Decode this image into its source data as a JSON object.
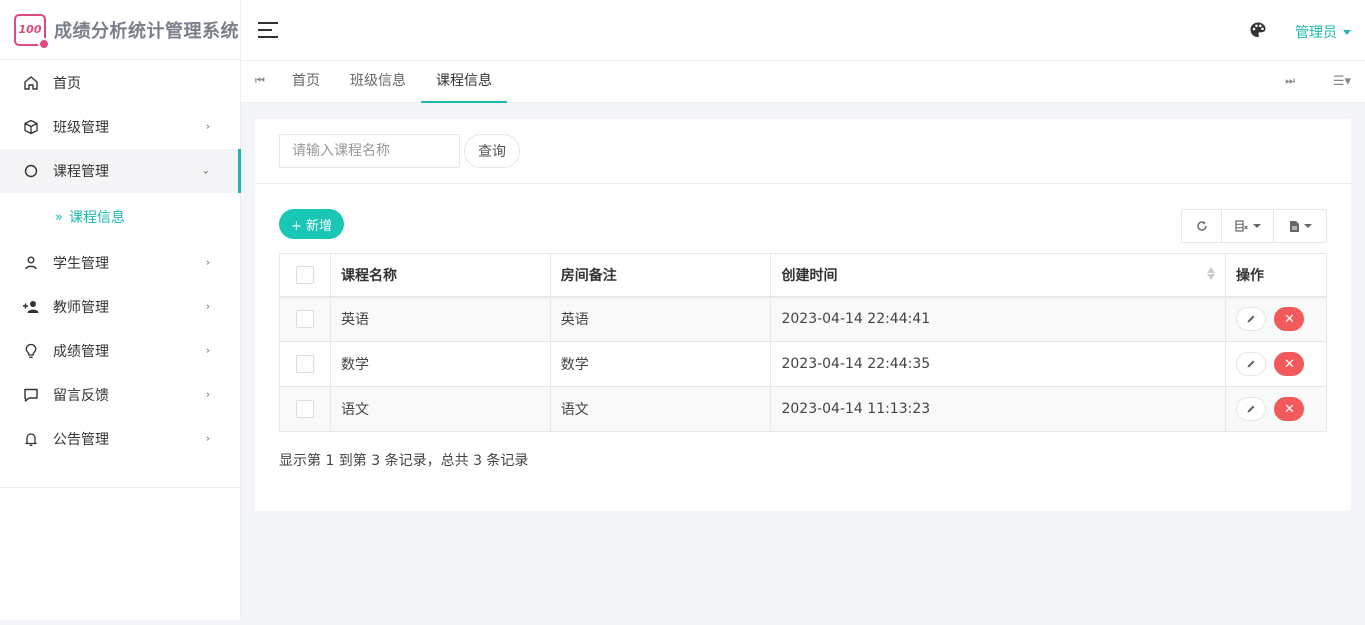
{
  "app": {
    "title": "成绩分析统计管理系统",
    "logo_text": "100"
  },
  "sidebar": {
    "items": [
      {
        "label": "首页",
        "icon": "home-icon",
        "has_arrow": false
      },
      {
        "label": "班级管理",
        "icon": "cube-icon",
        "has_arrow": true
      },
      {
        "label": "课程管理",
        "icon": "gear-icon",
        "has_arrow": true,
        "expanded": true
      },
      {
        "label": "学生管理",
        "icon": "user-icon",
        "has_arrow": true
      },
      {
        "label": "教师管理",
        "icon": "user-plus-icon",
        "has_arrow": true
      },
      {
        "label": "成绩管理",
        "icon": "lightbulb-icon",
        "has_arrow": true
      },
      {
        "label": "留言反馈",
        "icon": "comment-icon",
        "has_arrow": true
      },
      {
        "label": "公告管理",
        "icon": "bell-icon",
        "has_arrow": true
      }
    ],
    "submenu": {
      "label": "课程信息"
    }
  },
  "header": {
    "user": "管理员"
  },
  "tabs": [
    {
      "label": "首页",
      "active": false
    },
    {
      "label": "班级信息",
      "active": false
    },
    {
      "label": "课程信息",
      "active": true
    }
  ],
  "search": {
    "placeholder": "请输入课程名称",
    "button": "查询"
  },
  "toolbar": {
    "add_label": "+ 新增"
  },
  "table": {
    "headers": [
      "课程名称",
      "房间备注",
      "创建时间",
      "操作"
    ],
    "rows": [
      {
        "name": "英语",
        "note": "英语",
        "created": "2023-04-14 22:44:41"
      },
      {
        "name": "数学",
        "note": "数学",
        "created": "2023-04-14 22:44:35"
      },
      {
        "name": "语文",
        "note": "语文",
        "created": "2023-04-14 11:13:23"
      }
    ]
  },
  "pagination": {
    "info": "显示第 1 到第 3 条记录，总共 3 条记录"
  },
  "colors": {
    "accent": "#1ab8b0",
    "add": "#19c7b6",
    "danger": "#f2595b",
    "logo": "#e04a7e"
  }
}
